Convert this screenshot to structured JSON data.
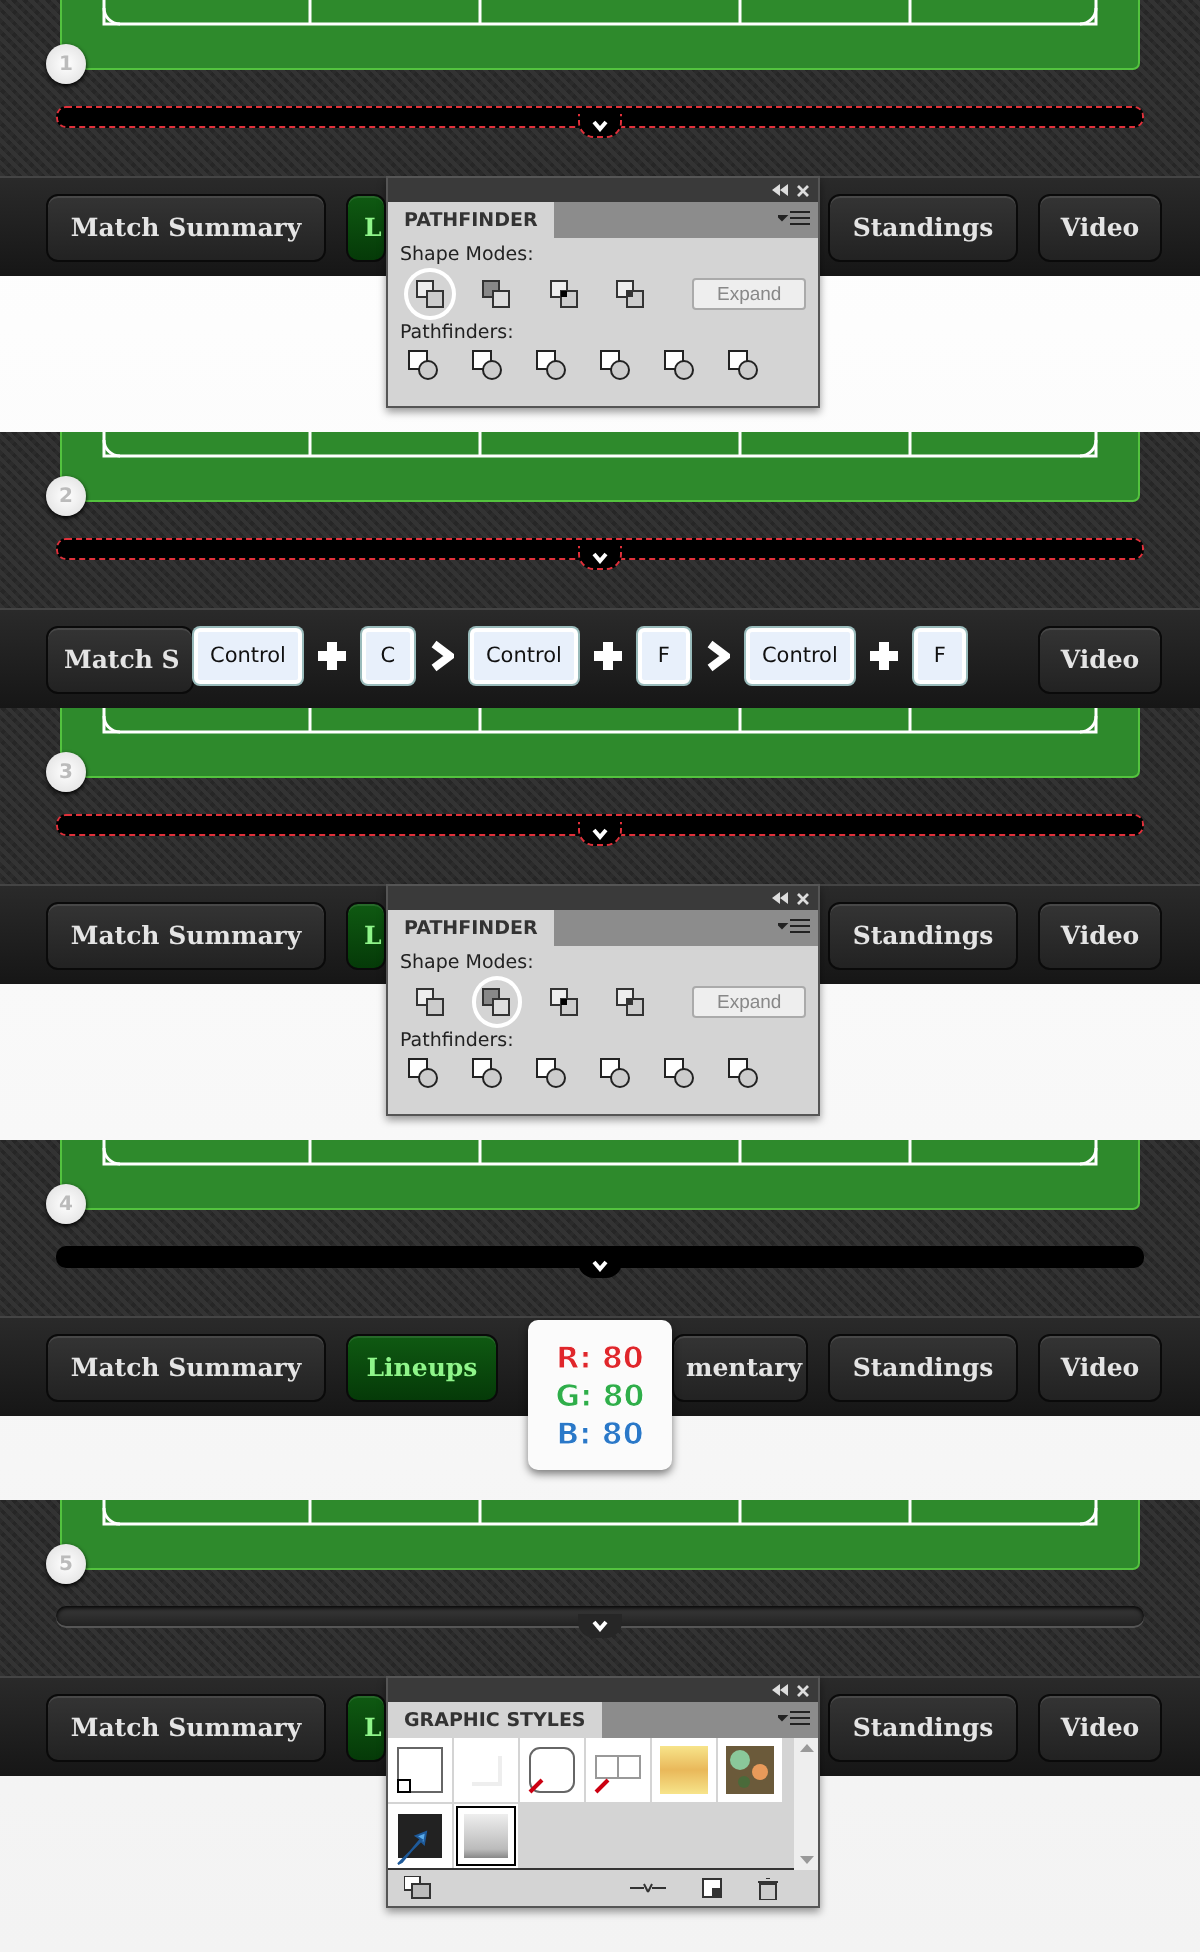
{
  "steps": [
    {
      "number": "1",
      "bar": {
        "selected": true,
        "styled": false
      },
      "nav": {
        "match_summary": {
          "label": "Match Summary",
          "selected": false
        },
        "lineups": {
          "label": "L",
          "selected": true
        },
        "standings": {
          "label": "Standings",
          "selected": false
        },
        "video": {
          "label": "Video",
          "selected": false
        }
      },
      "overlay": {
        "kind": "pathfinder",
        "tab": "PATHFINDER",
        "shape_modes_label": "Shape Modes:",
        "shape_modes": [
          {
            "selected": true
          },
          {
            "selected": false
          },
          {
            "selected": false
          },
          {
            "selected": false
          }
        ],
        "expand": {
          "label": "Expand",
          "disabled": true
        },
        "pathfinders_label": "Pathfinders:"
      }
    },
    {
      "number": "2",
      "bar": {
        "selected": true,
        "styled": false
      },
      "nav": {
        "match_summary": {
          "label": "Match S",
          "selected": false
        },
        "video": {
          "label": "Video",
          "selected": false
        }
      },
      "overlay": {
        "kind": "shortcut",
        "keys": [
          {
            "kind": "key",
            "label": "Control"
          },
          {
            "kind": "plus"
          },
          {
            "kind": "key",
            "label": "C"
          },
          {
            "kind": "arrow"
          },
          {
            "kind": "key",
            "label": "Control"
          },
          {
            "kind": "plus"
          },
          {
            "kind": "key",
            "label": "F"
          },
          {
            "kind": "arrow"
          },
          {
            "kind": "key",
            "label": "Control"
          },
          {
            "kind": "plus"
          },
          {
            "kind": "key",
            "label": "F"
          }
        ]
      }
    },
    {
      "number": "3",
      "bar": {
        "selected": true,
        "styled": false
      },
      "nav": {
        "match_summary": {
          "label": "Match Summary",
          "selected": false
        },
        "lineups": {
          "label": "L",
          "selected": true
        },
        "standings": {
          "label": "Standings",
          "selected": false
        },
        "video": {
          "label": "Video",
          "selected": false
        }
      },
      "overlay": {
        "kind": "pathfinder",
        "tab": "PATHFINDER",
        "shape_modes_label": "Shape Modes:",
        "shape_modes": [
          {
            "selected": false
          },
          {
            "selected": true
          },
          {
            "selected": false
          },
          {
            "selected": false
          }
        ],
        "expand": {
          "label": "Expand",
          "disabled": true
        },
        "pathfinders_label": "Pathfinders:"
      }
    },
    {
      "number": "4",
      "bar": {
        "selected": false,
        "styled": false
      },
      "nav": {
        "match_summary": {
          "label": "Match Summary",
          "selected": false
        },
        "lineups": {
          "label": "Lineups",
          "selected": true
        },
        "commentary": {
          "label": "mentary",
          "selected": false
        },
        "standings": {
          "label": "Standings",
          "selected": false
        },
        "video": {
          "label": "Video",
          "selected": false
        }
      },
      "overlay": {
        "kind": "color_readout",
        "channels": [
          {
            "label": "R: 80",
            "color": "#e0262b"
          },
          {
            "label": "G: 80",
            "color": "#2fae4a"
          },
          {
            "label": "B: 80",
            "color": "#2a78c8"
          }
        ]
      }
    },
    {
      "number": "5",
      "bar": {
        "selected": false,
        "styled": true
      },
      "nav": {
        "match_summary": {
          "label": "Match Summary",
          "selected": false
        },
        "lineups": {
          "label": "L",
          "selected": true
        },
        "standings": {
          "label": "Standings",
          "selected": false
        },
        "video": {
          "label": "Video",
          "selected": false
        }
      },
      "overlay": {
        "kind": "graphic_styles",
        "tab": "GRAPHIC STYLES",
        "styles": [
          {
            "kind": "default",
            "selected": false
          },
          {
            "kind": "shadow",
            "selected": false
          },
          {
            "kind": "none_rounded",
            "selected": false
          },
          {
            "kind": "none_split",
            "selected": false
          },
          {
            "kind": "gold",
            "selected": false
          },
          {
            "kind": "camo",
            "selected": false
          },
          {
            "kind": "dark",
            "selected": false
          },
          {
            "kind": "silver",
            "selected": true
          }
        ]
      }
    }
  ]
}
